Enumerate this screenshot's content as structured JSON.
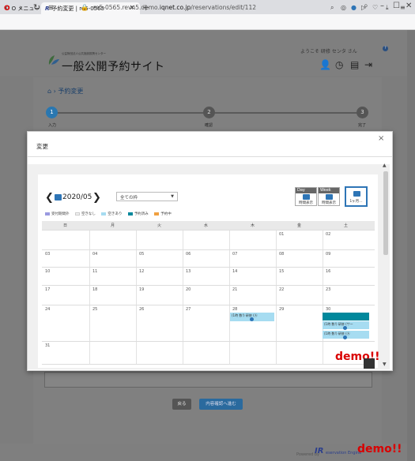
{
  "browser": {
    "menu_tab_label": "O メニュー",
    "active_tab_label": "予約変更 | re5-0565",
    "tab_close": "×",
    "new_tab": "+",
    "url_host": "re5-0565.revn5.demo.",
    "url_domain": "iqnet.co.jp",
    "url_path": "/reservations/edit/112"
  },
  "header": {
    "org_line": "公益財団法人公共施設振興センター",
    "site_title": "一般公開予約サイト",
    "welcome": "ようこそ 研修 センタ さん"
  },
  "breadcrumb": "予約変更",
  "steps": [
    {
      "num": "1",
      "label": "入力"
    },
    {
      "num": "2",
      "label": "確認"
    },
    {
      "num": "3",
      "label": "完了"
    }
  ],
  "modal": {
    "title": "変更",
    "close": "×"
  },
  "calendar": {
    "month": "2020/05",
    "frame_select": "全ての枠",
    "views": [
      {
        "tag": "Day",
        "label": "時間表示"
      },
      {
        "tag": "Week",
        "label": "時間表示"
      },
      {
        "tag": "",
        "label": "1ヶ月…"
      }
    ],
    "legend": [
      {
        "label": "受付期間外",
        "color": "#9a9ae0"
      },
      {
        "label": "空きなし",
        "color": "#f0f0f0"
      },
      {
        "label": "空きあり",
        "color": "#a6dcf1"
      },
      {
        "label": "予約済み",
        "color": "#00889c"
      },
      {
        "label": "予約中",
        "color": "#f0a040"
      }
    ],
    "weekdays": [
      "日",
      "月",
      "火",
      "水",
      "木",
      "金",
      "土"
    ],
    "weeks": [
      [
        "",
        "",
        "",
        "",
        "",
        "01",
        "02"
      ],
      [
        "03",
        "04",
        "05",
        "06",
        "07",
        "08",
        "09"
      ],
      [
        "10",
        "11",
        "12",
        "13",
        "14",
        "15",
        "16"
      ],
      [
        "17",
        "18",
        "19",
        "20",
        "21",
        "22",
        "23"
      ],
      [
        "24",
        "25",
        "26",
        "27",
        "28",
        "29",
        "30"
      ],
      [
        "31",
        "",
        "",
        "",
        "",
        "",
        ""
      ]
    ],
    "event_thu28": "(1時 数!) 研修 (Ⓐ",
    "events_sat30": [
      "(1時 数!) 研修 (サー",
      "(1時 数!) 研修 (Ⓐ"
    ]
  },
  "watermark": "demo!!",
  "buttons": {
    "back": "戻る",
    "confirm": "内容確認へ進む"
  },
  "footer": {
    "powered": "Powered by",
    "brand": "IR",
    "brand_small": "eservation Engine"
  }
}
